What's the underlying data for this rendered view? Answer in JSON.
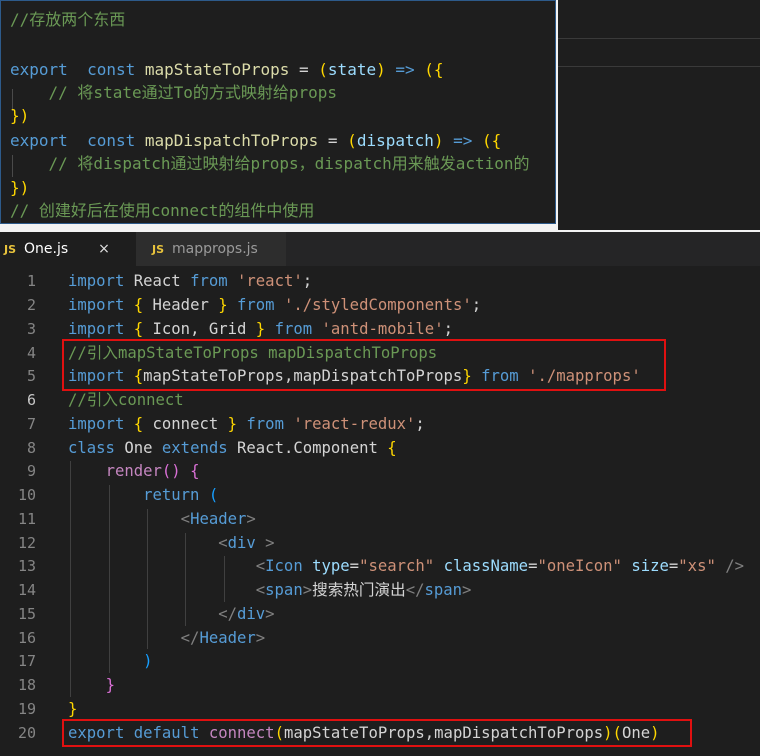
{
  "snippet": {
    "comment1": "//存放两个东西",
    "l2": {
      "kw1": "export",
      "kw2": "const",
      "name": "mapStateToProps",
      "eq": " = ",
      "p1": "(",
      "param": "state",
      "p2": ")",
      "arrow": " => ",
      "b1": "({"
    },
    "l3": "// 将state通过To的方式映射给props",
    "l4": "})",
    "l5": {
      "kw1": "export",
      "kw2": "const",
      "name": "mapDispatchToProps",
      "eq": " = ",
      "p1": "(",
      "param": "dispatch",
      "p2": ")",
      "arrow": " => ",
      "b1": "({"
    },
    "l6": "// 将dispatch通过映射给props，dispatch用来触发action的",
    "l7": "})",
    "l8": "// 创建好后在使用connect的组件中使用"
  },
  "tabs": [
    {
      "icon": "JS",
      "label": "One.js",
      "close": "×"
    },
    {
      "icon": "JS",
      "label": "mapprops.js"
    }
  ],
  "line_numbers": [
    "1",
    "2",
    "3",
    "4",
    "5",
    "6",
    "7",
    "8",
    "9",
    "10",
    "11",
    "12",
    "13",
    "14",
    "15",
    "16",
    "17",
    "18",
    "19",
    "20"
  ],
  "code": {
    "l1": {
      "kw": "import",
      "t1": " React ",
      "from": "from",
      "t2": " ",
      "str": "'react'",
      "end": ";"
    },
    "l2": {
      "kw": "import",
      "t1": " ",
      "b1": "{",
      "t2": " Header ",
      "b2": "}",
      "t3": " ",
      "from": "from",
      "t4": " ",
      "str": "'./styledComponents'",
      "end": ";"
    },
    "l3": {
      "kw": "import",
      "t1": " ",
      "b1": "{",
      "t2": " Icon, Grid ",
      "b2": "}",
      "t3": " ",
      "from": "from",
      "t4": " ",
      "str": "'antd-mobile'",
      "end": ";"
    },
    "l4": "//引入mapStateToProps mapDispatchToProps",
    "l5": {
      "kw": "import",
      "t1": " ",
      "b1": "{",
      "t2": "mapStateToProps,mapDispatchToProps",
      "b2": "}",
      "t3": " ",
      "from": "from",
      "t4": " ",
      "str": "'./mapprops'"
    },
    "l6": "//引入connect",
    "l7": {
      "kw": "import",
      "t1": " ",
      "b1": "{",
      "t2": " connect ",
      "b2": "}",
      "t3": " ",
      "from": "from",
      "t4": " ",
      "str": "'react-redux'",
      "end": ";"
    },
    "l8": {
      "kw": "class",
      "t1": " ",
      "cls1": "One",
      "t2": " ",
      "ext": "extends",
      "t3": " ",
      "cls2": "React",
      "dot": ".",
      "cls3": "Component",
      "t4": " ",
      "b1": "{"
    },
    "l9": {
      "fn": "render",
      "p": "()",
      "t1": " ",
      "b1": "{"
    },
    "l10": {
      "kw": "return",
      "t1": " ",
      "p": "("
    },
    "l11": {
      "lt": "<",
      "tag": "Header",
      "gt": ">"
    },
    "l12": {
      "lt": "<",
      "tag": "div",
      "t1": " ",
      "gt": ">"
    },
    "l13": {
      "lt": "<",
      "tag": "Icon",
      "t1": " ",
      "a1": "type",
      "e1": "=",
      "v1": "\"search\"",
      "t2": " ",
      "a2": "className",
      "e2": "=",
      "v2": "\"oneIcon\"",
      "t3": " ",
      "a3": "size",
      "e3": "=",
      "v3": "\"xs\"",
      "t4": " ",
      "end": "/>"
    },
    "l14": {
      "lt": "<",
      "tag": "span",
      "gt": ">",
      "text": "搜索热门演出",
      "lt2": "</",
      "tag2": "span",
      "gt2": ">"
    },
    "l15": {
      "lt": "</",
      "tag": "div",
      "gt": ">"
    },
    "l16": {
      "lt": "</",
      "tag": "Header",
      "gt": ">"
    },
    "l17": ")",
    "l18": "}",
    "l19": "}",
    "l20": {
      "kw1": "export",
      "t1": " ",
      "kw2": "default",
      "t2": " ",
      "fn": "connect",
      "p1": "(",
      "args": "mapStateToProps,mapDispatchToProps",
      "p2": ")",
      "p3": "(",
      "arg2": "One",
      "p4": ")"
    }
  }
}
